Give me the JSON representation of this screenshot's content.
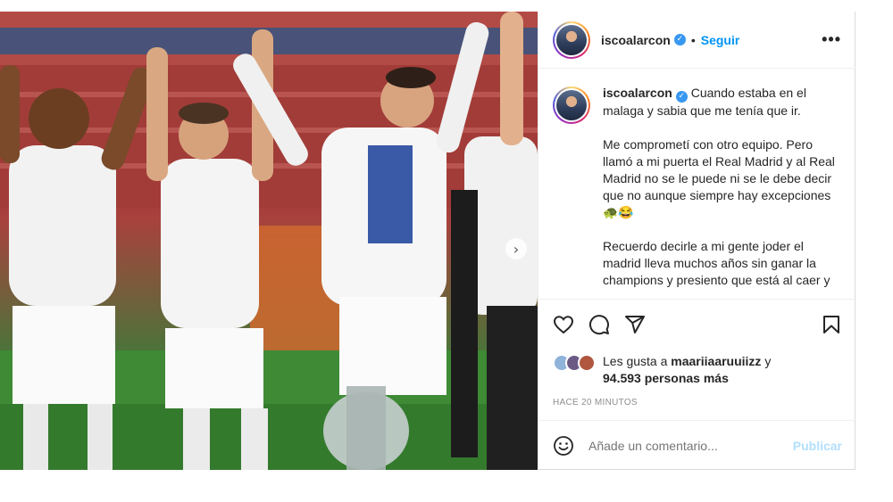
{
  "post": {
    "next_glyph": "›"
  },
  "header": {
    "username": "iscoalarcon",
    "verified_glyph": "✓",
    "separator": "•",
    "follow_label": "Seguir",
    "more_glyph": "•••"
  },
  "caption": {
    "username": "iscoalarcon",
    "paragraph_1": "Cuando estaba en el malaga y sabia que me tenía que ir.",
    "paragraph_2": "Me comprometí con otro equipo. Pero llamó a mi puerta el Real Madrid y al Real Madrid no se le puede ni se le debe decir que no aunque siempre hay excepciones 🐢😂",
    "paragraph_3": "Recuerdo decirle a mi gente joder el madrid lleva muchos años sin ganar la champions y presiento que está al caer y"
  },
  "actions": {
    "icons": [
      "heart-icon",
      "comment-icon",
      "share-icon",
      "bookmark-icon"
    ]
  },
  "likes": {
    "prefix": "Les gusta a",
    "user": "maariiaaruuiizz",
    "connector": "y",
    "count_text": "94.593 personas más"
  },
  "timestamp": "HACE 20 MINUTOS",
  "comment": {
    "placeholder": "Añade un comentario...",
    "publish_label": "Publicar"
  },
  "colors": {
    "accent": "#0095f6",
    "publish_disabled": "#b2dffc",
    "verified": "#3897f0",
    "muted": "#8e8e8e"
  }
}
